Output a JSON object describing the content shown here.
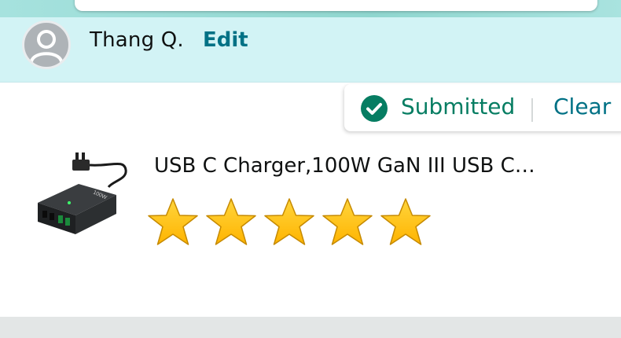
{
  "profile": {
    "name": "Thang Q.",
    "edit_label": "Edit"
  },
  "status": {
    "submitted_label": "Submitted",
    "clear_label": "Clear",
    "check_icon": "check-circle-icon"
  },
  "product": {
    "title": "USB C Charger,100W GaN III USB C…",
    "image": "usb-charger-product-image",
    "rating": 5,
    "rating_max": 5
  },
  "colors": {
    "profile_bg": "#d2f3f5",
    "link": "#007185",
    "success": "#067d62",
    "star_fill": "#ffb400"
  }
}
